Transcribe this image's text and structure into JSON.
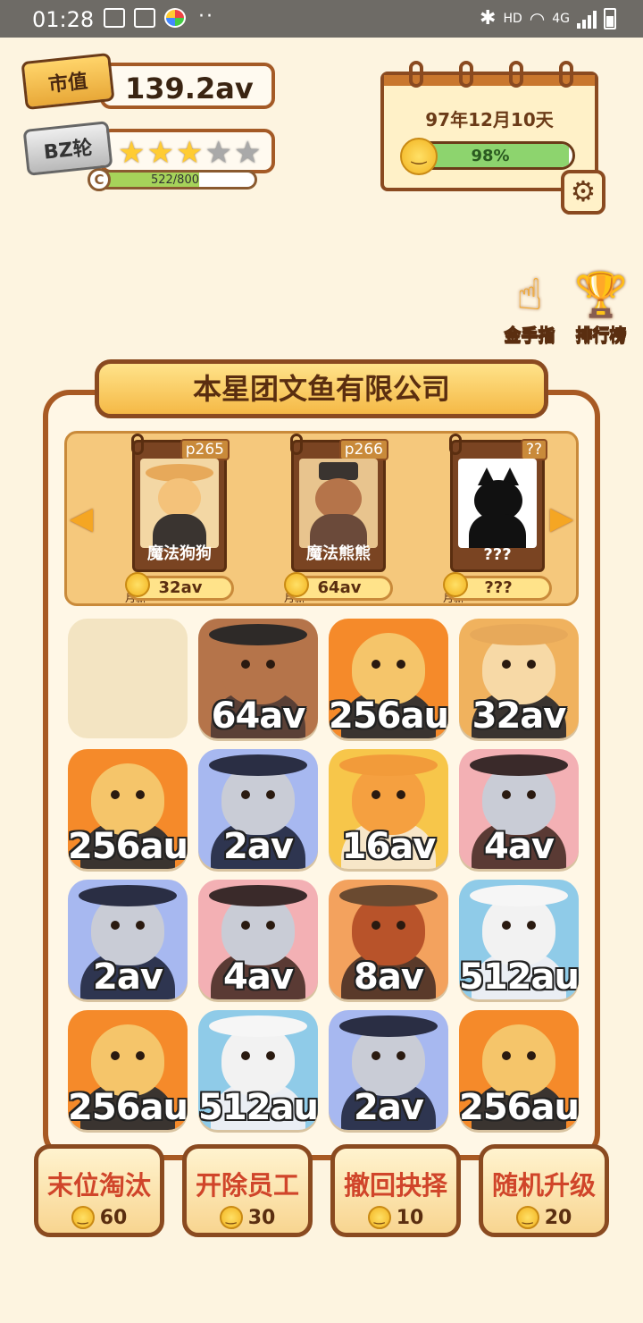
{
  "status_bar": {
    "time": "01:28",
    "network": "4G",
    "hd": "HD",
    "dots": "··"
  },
  "header": {
    "market_value_label": "市值",
    "market_value": "139.2av",
    "rank_label": "BZ轮",
    "stars_filled": 3,
    "stars_total": 5,
    "xp_text": "522/800",
    "xp_fraction": 0.6525,
    "xp_icon": "C"
  },
  "calendar": {
    "date": "97年12月10天",
    "mood_percent": "98%",
    "mood_fraction": 0.98
  },
  "side_buttons": {
    "gold_finger": "金手指",
    "leaderboard": "排行榜"
  },
  "company": {
    "name": "本星团文鱼有限公司"
  },
  "carousel": {
    "employees": [
      {
        "tag": "p265",
        "name": "魔法狗狗",
        "salary": "32av",
        "salary_label": "月薪",
        "kind": "dog"
      },
      {
        "tag": "p266",
        "name": "魔法熊熊",
        "salary": "64av",
        "salary_label": "月薪",
        "kind": "bear"
      },
      {
        "tag": "??",
        "name": "???",
        "salary": "???",
        "salary_label": "月薪",
        "kind": "unknown"
      }
    ]
  },
  "grid": {
    "tiles": [
      {
        "label": "",
        "kind": "empty"
      },
      {
        "label": "64av",
        "kind": "bear"
      },
      {
        "label": "256au",
        "kind": "leopard"
      },
      {
        "label": "32av",
        "kind": "dog"
      },
      {
        "label": "256au",
        "kind": "leopard"
      },
      {
        "label": "2av",
        "kind": "mouse"
      },
      {
        "label": "16av",
        "kind": "fox"
      },
      {
        "label": "4av",
        "kind": "chinchilla"
      },
      {
        "label": "2av",
        "kind": "mouse"
      },
      {
        "label": "4av",
        "kind": "chinchilla"
      },
      {
        "label": "8av",
        "kind": "redpanda"
      },
      {
        "label": "512au",
        "kind": "eagle"
      },
      {
        "label": "256au",
        "kind": "leopard"
      },
      {
        "label": "512au",
        "kind": "eagle"
      },
      {
        "label": "2av",
        "kind": "mouse"
      },
      {
        "label": "256au",
        "kind": "leopard"
      }
    ]
  },
  "actions": [
    {
      "label": "末位淘汰",
      "cost": "60"
    },
    {
      "label": "开除员工",
      "cost": "30"
    },
    {
      "label": "撤回抉择",
      "cost": "10"
    },
    {
      "label": "随机升级",
      "cost": "20"
    }
  ],
  "palette": {
    "leopard": "#f58a2a",
    "bear": "#b5744a",
    "dog": "#f0b25e",
    "mouse": "#a7b8f0",
    "fox": "#f7c64a",
    "chinchilla": "#f3b0b4",
    "redpanda": "#f3a25e",
    "eagle": "#8fcbe8"
  }
}
